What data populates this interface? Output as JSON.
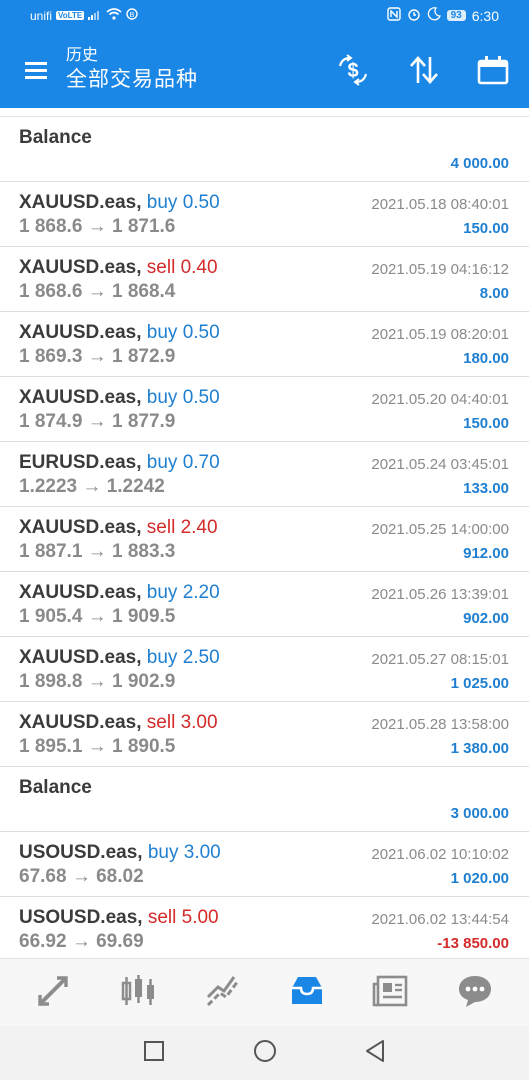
{
  "status_bar": {
    "carrier": "unifi",
    "network_badge": "VoLTE",
    "battery": "93",
    "time": "6:30"
  },
  "app_bar": {
    "subtitle": "历史",
    "title": "全部交易品种",
    "icons": [
      "menu-icon",
      "deposit-icon",
      "sort-icon",
      "calendar-icon"
    ]
  },
  "rows": [
    {
      "type": "balance",
      "label": "Balance",
      "amount": "4 000.00"
    },
    {
      "type": "trade",
      "symbol": "XAUUSD.eas,",
      "side": "buy",
      "volume": "0.50",
      "open": "1 868.6",
      "close": "1 871.6",
      "date": "2021.05.18 08:40:01",
      "amount": "150.00"
    },
    {
      "type": "trade",
      "symbol": "XAUUSD.eas,",
      "side": "sell",
      "volume": "0.40",
      "open": "1 868.6",
      "close": "1 868.4",
      "date": "2021.05.19 04:16:12",
      "amount": "8.00"
    },
    {
      "type": "trade",
      "symbol": "XAUUSD.eas,",
      "side": "buy",
      "volume": "0.50",
      "open": "1 869.3",
      "close": "1 872.9",
      "date": "2021.05.19 08:20:01",
      "amount": "180.00"
    },
    {
      "type": "trade",
      "symbol": "XAUUSD.eas,",
      "side": "buy",
      "volume": "0.50",
      "open": "1 874.9",
      "close": "1 877.9",
      "date": "2021.05.20 04:40:01",
      "amount": "150.00"
    },
    {
      "type": "trade",
      "symbol": "EURUSD.eas,",
      "side": "buy",
      "volume": "0.70",
      "open": "1.2223",
      "close": "1.2242",
      "date": "2021.05.24 03:45:01",
      "amount": "133.00"
    },
    {
      "type": "trade",
      "symbol": "XAUUSD.eas,",
      "side": "sell",
      "volume": "2.40",
      "open": "1 887.1",
      "close": "1 883.3",
      "date": "2021.05.25 14:00:00",
      "amount": "912.00"
    },
    {
      "type": "trade",
      "symbol": "XAUUSD.eas,",
      "side": "buy",
      "volume": "2.20",
      "open": "1 905.4",
      "close": "1 909.5",
      "date": "2021.05.26 13:39:01",
      "amount": "902.00"
    },
    {
      "type": "trade",
      "symbol": "XAUUSD.eas,",
      "side": "buy",
      "volume": "2.50",
      "open": "1 898.8",
      "close": "1 902.9",
      "date": "2021.05.27 08:15:01",
      "amount": "1 025.00"
    },
    {
      "type": "trade",
      "symbol": "XAUUSD.eas,",
      "side": "sell",
      "volume": "3.00",
      "open": "1 895.1",
      "close": "1 890.5",
      "date": "2021.05.28 13:58:00",
      "amount": "1 380.00"
    },
    {
      "type": "balance",
      "label": "Balance",
      "amount": "3 000.00"
    },
    {
      "type": "trade",
      "symbol": "USOUSD.eas,",
      "side": "buy",
      "volume": "3.00",
      "open": "67.68",
      "close": "68.02",
      "date": "2021.06.02 10:10:02",
      "amount": "1 020.00"
    },
    {
      "type": "trade",
      "symbol": "USOUSD.eas,",
      "side": "sell",
      "volume": "5.00",
      "open": "66.92",
      "close": "69.69",
      "date": "2021.06.02 13:44:54",
      "amount": "-13 850.00",
      "negative": true
    }
  ],
  "bottom_nav": {
    "items": [
      "quotes-icon",
      "chart-candles-icon",
      "trade-icon",
      "history-icon",
      "news-icon",
      "chat-icon"
    ],
    "active": 3
  },
  "system_nav": [
    "recents-icon",
    "home-icon",
    "back-icon"
  ],
  "colors": {
    "primary": "#1a86e6",
    "buy": "#1f7fd0",
    "sell": "#d42a2a",
    "muted": "#8a8a8a"
  }
}
